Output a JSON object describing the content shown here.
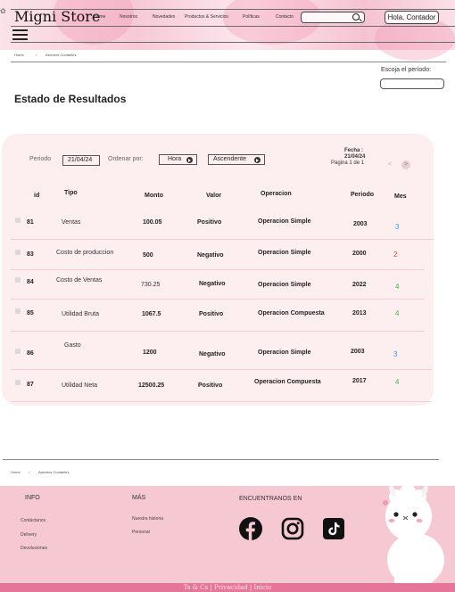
{
  "header": {
    "logo": "Migni Store",
    "nav": [
      "Home",
      "Nosotros",
      "Novedades",
      "Productos & Servicios",
      "Políticas",
      "Contacto"
    ],
    "search_placeholder": "",
    "greeting": "Hola, Contador"
  },
  "breadcrumb": {
    "home": "Home",
    "sep": "/",
    "current": "Asientos Contables"
  },
  "period_picker": {
    "label": "Escoja el período:",
    "value": ""
  },
  "page_title": "Estado de Resultados",
  "controls": {
    "periodo_label": "Periodo",
    "periodo_value": "21/04/24",
    "ordenar_label": "Ordenar por:",
    "order_field": "Hora",
    "order_dir": "Ascendente",
    "fecha_label": "Fecha :",
    "fecha_value": "21/04/24",
    "pagination": "Página 1 de 1",
    "prev": "<",
    "next": ">"
  },
  "table": {
    "headers": [
      "id",
      "Tipo",
      "Monto",
      "Valor",
      "Operacion",
      "Periodo",
      "Mes"
    ],
    "rows": [
      {
        "id": "81",
        "tipo": "Ventas",
        "monto": "100.05",
        "valor": "Positivo",
        "operacion": "Operacion Simple",
        "periodo": "2003",
        "mes": "3"
      },
      {
        "id": "83",
        "tipo": "Costo de produccion",
        "monto": "500",
        "valor": "Negativo",
        "operacion": "Operacion Simple",
        "periodo": "2000",
        "mes": "2"
      },
      {
        "id": "84",
        "tipo": "Costo de Ventas",
        "monto": "730.25",
        "valor": "Negativo",
        "operacion": "Operacion Simple",
        "periodo": "2022",
        "mes": "4"
      },
      {
        "id": "85",
        "tipo": "Utilidad Bruta",
        "monto": "1067.5",
        "valor": "Positivo",
        "operacion": "Operacion Compuesta",
        "periodo": "2013",
        "mes": "4"
      },
      {
        "id": "86",
        "tipo": "Gasto",
        "monto": "1200",
        "valor": "Negativo",
        "operacion": "Operacion Simple",
        "periodo": "2003",
        "mes": "3"
      },
      {
        "id": "87",
        "tipo": "Utilidad Neta",
        "monto": "12500.25",
        "valor": "Positivo",
        "operacion": "Operacion Compuesta",
        "periodo": "2017",
        "mes": "4"
      }
    ]
  },
  "mes_colors": {
    "3": "#4a90d9",
    "2": "#d9463b",
    "4": "#4caf50"
  },
  "footer_breadcrumb": {
    "home": "Home",
    "sep": "/",
    "current": "Asientos Contables"
  },
  "footer": {
    "info_title": "INFO",
    "info_links": [
      "Contáctanos",
      "Delivery",
      "Devoluciones"
    ],
    "mas_title": "MÁS",
    "mas_links": [
      "Nuestra historia",
      "Personal"
    ],
    "social_title": "ENCUENTRANOS EN",
    "social_icons": [
      "facebook-icon",
      "instagram-icon",
      "tiktok-icon"
    ],
    "bottom_text": "Ts & Cs |  Privacidad  | Inicio"
  }
}
